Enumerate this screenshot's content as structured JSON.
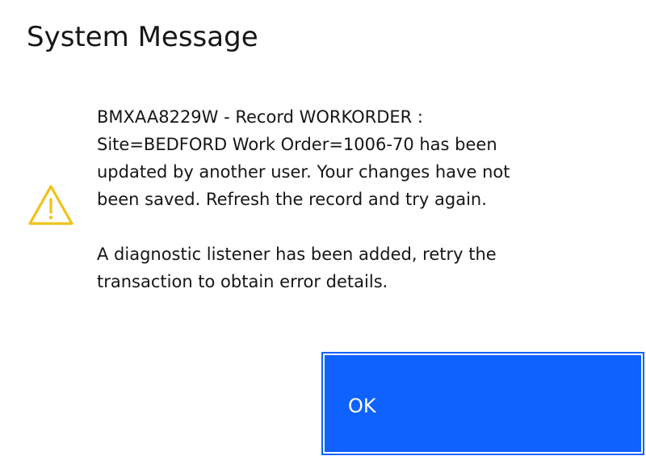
{
  "dialog": {
    "title": "System Message",
    "icon": "warning-triangle-icon",
    "icon_color": "#f1c21b",
    "message_lines": [
      "BMXAA8229W - Record WORKORDER :",
      "Site=BEDFORD Work Order=1006-70 has been",
      "updated by another user. Your changes have not",
      "been saved. Refresh the record and try again."
    ],
    "detail_lines": [
      "A diagnostic listener has been added, retry the",
      "transaction to obtain error details."
    ],
    "ok_label": "OK",
    "button_color": "#0f62fe"
  }
}
